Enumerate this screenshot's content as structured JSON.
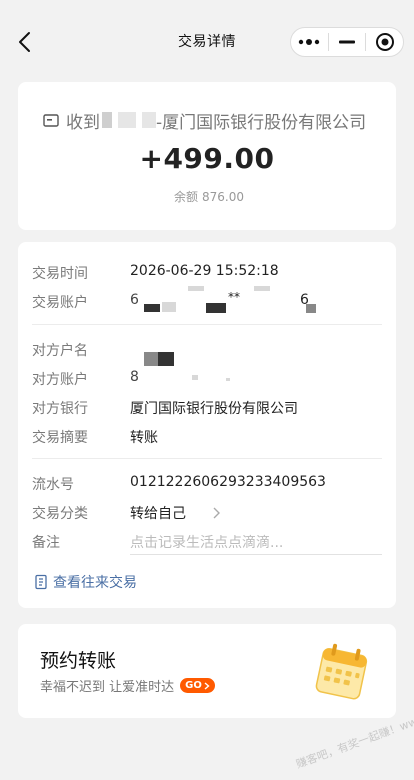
{
  "nav": {
    "title": "交易详情",
    "back_icon": "chevron-left-icon",
    "more_icon": "more-dots-icon",
    "minimize_icon": "minimize-icon",
    "close_icon": "target-close-icon"
  },
  "summary": {
    "party_prefix": "收到",
    "party_bank": "-厦门国际银行股份有限公司",
    "amount": "+499.00",
    "balance_label": "余额",
    "balance_value": "876.00"
  },
  "details": {
    "time_label": "交易时间",
    "time_value": "2026-06-29 15:52:18",
    "account_label": "交易账户",
    "account_value_start": "6",
    "account_value_stars": "**",
    "account_value_end": "6",
    "counterparty_name_label": "对方户名",
    "counterparty_account_label": "对方账户",
    "counterparty_account_start": "8",
    "counterparty_bank_label": "对方银行",
    "counterparty_bank_value": "厦门国际银行股份有限公司",
    "summary_label": "交易摘要",
    "summary_value": "转账",
    "serial_label": "流水号",
    "serial_value": "0121222606293233409563",
    "category_label": "交易分类",
    "category_value": "转给自己",
    "note_label": "备注",
    "note_placeholder": "点击记录生活点点滴滴..."
  },
  "history_link": "查看往来交易",
  "promo": {
    "title": "预约转账",
    "subtitle": "幸福不迟到 让爱准时达",
    "go_label": "GO",
    "image_icon": "calendar-icon"
  },
  "watermark": "赚客吧，有奖一起赚！www.zuanke8.com",
  "colors": {
    "background": "#f2f2f2",
    "card": "#ffffff",
    "link": "#4a6fa5",
    "go_button": "#ff5a00"
  }
}
